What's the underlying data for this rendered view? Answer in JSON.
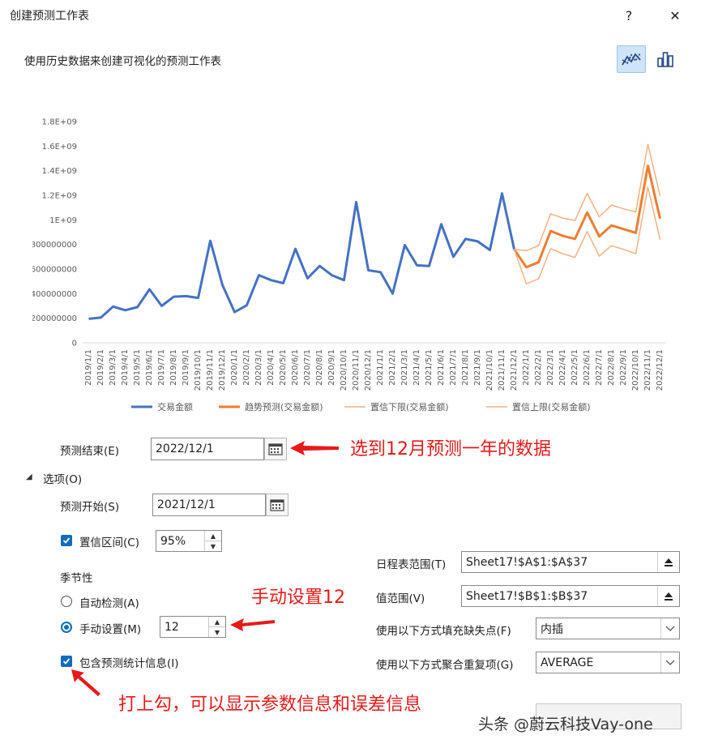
{
  "window": {
    "title": "创建预测工作表",
    "help_label": "?",
    "close_label": "✕",
    "subtitle": "使用历史数据来创建可视化的预测工作表"
  },
  "view_buttons": [
    {
      "name": "line-chart-icon",
      "active": true
    },
    {
      "name": "bar-chart-icon",
      "active": false
    }
  ],
  "chart_data": {
    "type": "line",
    "x": [
      "2019/1/1",
      "2019/2/1",
      "2019/3/1",
      "2019/4/1",
      "2019/5/1",
      "2019/6/1",
      "2019/7/1",
      "2019/8/1",
      "2019/9/1",
      "2019/10/1",
      "2019/11/1",
      "2019/12/1",
      "2020/1/1",
      "2020/2/1",
      "2020/3/1",
      "2020/4/1",
      "2020/5/1",
      "2020/6/1",
      "2020/7/1",
      "2020/8/1",
      "2020/9/1",
      "2020/10/1",
      "2020/11/1",
      "2020/12/1",
      "2021/1/1",
      "2021/2/1",
      "2021/3/1",
      "2021/4/1",
      "2021/5/1",
      "2021/6/1",
      "2021/7/1",
      "2021/8/1",
      "2021/9/1",
      "2021/10/1",
      "2021/11/1",
      "2021/12/1",
      "2022/1/1",
      "2022/2/1",
      "2022/3/1",
      "2022/4/1",
      "2022/5/1",
      "2022/6/1",
      "2022/7/1",
      "2022/8/1",
      "2022/9/1",
      "2022/10/1",
      "2022/11/1",
      "2022/12/1"
    ],
    "y_ticks": [
      "0",
      "200000000",
      "400000000",
      "600000000",
      "800000000",
      "1E+09",
      "1.2E+09",
      "1.4E+09",
      "1.6E+09",
      "1.8E+09"
    ],
    "ylim": [
      0,
      1800000000
    ],
    "series": [
      {
        "name": "交易金额",
        "color": "#4472c4",
        "width": 3,
        "start": 0,
        "values": [
          195000000,
          205000000,
          295000000,
          265000000,
          290000000,
          435000000,
          300000000,
          375000000,
          380000000,
          365000000,
          830000000,
          470000000,
          250000000,
          305000000,
          550000000,
          510000000,
          485000000,
          765000000,
          525000000,
          625000000,
          550000000,
          510000000,
          1145000000,
          590000000,
          575000000,
          400000000,
          795000000,
          630000000,
          625000000,
          965000000,
          700000000,
          845000000,
          825000000,
          755000000,
          1215000000,
          760000000
        ]
      },
      {
        "name": "趋势预测(交易金额)",
        "color": "#ed7d31",
        "width": 3,
        "start": 35,
        "values": [
          760000000,
          615000000,
          655000000,
          910000000,
          870000000,
          845000000,
          1060000000,
          865000000,
          955000000,
          925000000,
          895000000,
          1440000000,
          1010000000
        ]
      },
      {
        "name": "置信下限(交易金额)",
        "color": "#f4b183",
        "width": 1.5,
        "start": 35,
        "values": [
          760000000,
          480000000,
          520000000,
          765000000,
          725000000,
          695000000,
          905000000,
          705000000,
          790000000,
          760000000,
          725000000,
          1265000000,
          840000000
        ]
      },
      {
        "name": "置信上限(交易金额)",
        "color": "#f4b183",
        "width": 1.5,
        "start": 35,
        "values": [
          760000000,
          750000000,
          790000000,
          1050000000,
          1015000000,
          995000000,
          1215000000,
          1025000000,
          1120000000,
          1090000000,
          1065000000,
          1615000000,
          1195000000
        ]
      }
    ],
    "legend_position": "bottom",
    "grid": false
  },
  "form": {
    "forecast_end_label": "预测结束(E)",
    "forecast_end_value": "2022/12/1",
    "options_label": "选项(O)",
    "forecast_start_label": "预测开始(S)",
    "forecast_start_value": "2021/12/1",
    "confidence_label": "置信区间(C)",
    "confidence_value": "95%",
    "seasonality_label": "季节性",
    "auto_detect_label": "自动检测(A)",
    "manual_label": "手动设置(M)",
    "manual_value": "12",
    "include_stats_label": "包含预测统计信息(I)",
    "timeline_label": "日程表范围(T)",
    "timeline_value": "Sheet17!$A$1:$A$37",
    "values_label": "值范围(V)",
    "values_value": "Sheet17!$B$1:$B$37",
    "fill_missing_label": "使用以下方式填充缺失点(F)",
    "fill_missing_value": "内插",
    "aggregate_label": "使用以下方式聚合重复项(G)",
    "aggregate_value": "AVERAGE"
  },
  "annotations": {
    "end_note": "选到12月预测一年的数据",
    "manual_note": "手动设置12",
    "stats_note": "打上勾，可以显示参数信息和误差信息"
  },
  "watermark": "头条 @蔚云科技Vay-one",
  "colors": {
    "accent": "#0f6cbd",
    "annotation": "#e8191a"
  }
}
